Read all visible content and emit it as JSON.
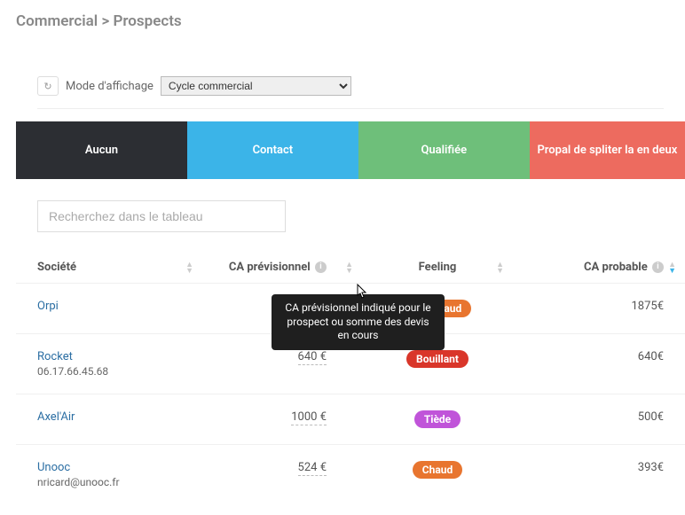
{
  "breadcrumb": {
    "part1": "Commercial",
    "sep": ">",
    "part2": "Prospects"
  },
  "toolbar": {
    "refresh_glyph": "↻",
    "mode_label": "Mode d'affichage",
    "mode_value": "Cycle commercial"
  },
  "tabs": {
    "t0": "Aucun",
    "t1": "Contact",
    "t2": "Qualifiée",
    "t3": "Propal de spliter la en deux"
  },
  "search": {
    "placeholder": "Recherchez dans le tableau"
  },
  "columns": {
    "societe": "Société",
    "ca_prev": "CA prévisionnel",
    "feeling": "Feeling",
    "ca_prob": "CA probable",
    "info_glyph": "i"
  },
  "tooltip": {
    "text": "CA prévisionnel indiqué pour le prospect ou somme des devis en cours"
  },
  "rows": [
    {
      "name": "Orpi",
      "sub": "",
      "ca_prev": "",
      "feeling": "Chaud",
      "feeling_cls": "b-chaud",
      "ca_prob": "1875€"
    },
    {
      "name": "Rocket",
      "sub": "06.17.66.45.68",
      "ca_prev": "640 €",
      "feeling": "Bouillant",
      "feeling_cls": "b-bouillant",
      "ca_prob": "640€"
    },
    {
      "name": "Axel'Air",
      "sub": "",
      "ca_prev": "1000 €",
      "feeling": "Tiède",
      "feeling_cls": "b-tiede",
      "ca_prob": "500€"
    },
    {
      "name": "Unooc",
      "sub": "nricard@unooc.fr",
      "ca_prev": "524 €",
      "feeling": "Chaud",
      "feeling_cls": "b-chaud",
      "ca_prob": "393€"
    }
  ]
}
